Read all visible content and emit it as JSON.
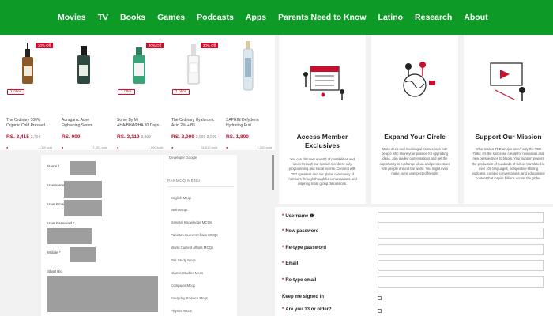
{
  "nav": [
    "Movies",
    "TV",
    "Books",
    "Games",
    "Podcasts",
    "Apps",
    "Parents Need to Know",
    "Latino",
    "Research",
    "About"
  ],
  "products": [
    {
      "name": "The Ordinary 100% Organic Cold Pressed...",
      "price": "RS. 3,415",
      "old_price": "3,794",
      "badge": "10% Off",
      "offer": "1 offer",
      "sold": "1.1M sold"
    },
    {
      "name": "Auraganic Acne Fightening Serum",
      "price": "RS. 999",
      "old_price": "",
      "badge": "",
      "offer": "",
      "sold": "1,001 sold"
    },
    {
      "name": "Some By Mi AHA/BHA/PHA 30 Days...",
      "price": "RS. 3,119",
      "old_price": "3,899",
      "badge": "20% Off",
      "offer": "1 offer",
      "sold": "1,000 sold"
    },
    {
      "name": "The Ordinary Hyaluronic Acid 2% + B5",
      "price": "RS. 2,099",
      "old_price": "2,999 3,000",
      "badge": "30% Off",
      "offer": "1 offer",
      "sold": "31,012 sold"
    },
    {
      "name": "SAPRIN Defyderm Hydrating Puri...",
      "price": "RS. 1,800",
      "old_price": "",
      "badge": "",
      "offer": "",
      "sold": "1,000 sold"
    }
  ],
  "cards": [
    {
      "title": "Access Member Exclusives",
      "text": "You can discover a world of possibilities and ideas through our special members-only programming and social events. Connect with TED speakers and our global community of members through thoughtful conversations and inspiring small group discussions."
    },
    {
      "title": "Expand Your Circle",
      "text": "Make deep and meaningful connections with people who share your passion for upgrading ideas. Join guided conversations and get the opportunity to exchange ideas and perspectives with people around the world. You might even make some unexpected friends!"
    },
    {
      "title": "Support Our Mission",
      "text": "What makes TED unique aren't only the TED Talks; it's the space we create for new ideas and new perspectives to bloom. Your support powers the production of hundreds of videos translated in over 100 languages, perspective-shifting podcasts, curated conversations, and educational content that inspire billions across the globe."
    }
  ],
  "user_form": {
    "fields": [
      "Name",
      "Username",
      "User Email",
      "User Password",
      "Mobile",
      "Short Bio"
    ]
  },
  "side_menu": {
    "top_item": "Developer Google",
    "heading": "PAKMCQ MENU",
    "items": [
      "English Mcqs",
      "Math Mcqs",
      "General Knowledge MCQs",
      "Pakistan Current Affairs MCQs",
      "World Current Affairs MCQs",
      "Pak Study Mcqs",
      "Islamic Studies Mcqs",
      "Computer Mcqs",
      "Everyday Science Mcqs",
      "Physics Mcqs"
    ]
  },
  "reg_form": {
    "fields": [
      {
        "label": "Username",
        "required": true,
        "info": true,
        "type": "input"
      },
      {
        "label": "New password",
        "required": true,
        "info": false,
        "type": "input"
      },
      {
        "label": "Re-type password",
        "required": true,
        "info": false,
        "type": "input"
      },
      {
        "label": "Email",
        "required": true,
        "info": false,
        "type": "input"
      },
      {
        "label": "Re-type email",
        "required": true,
        "info": false,
        "type": "input"
      },
      {
        "label": "Keep me signed in",
        "required": false,
        "info": false,
        "type": "checkbox"
      },
      {
        "label": "Are you 13 or older?",
        "required": true,
        "info": false,
        "type": "checkbox"
      }
    ]
  },
  "colors": {
    "brand_green": "#0d9a27",
    "accent_red": "#c8102e"
  }
}
